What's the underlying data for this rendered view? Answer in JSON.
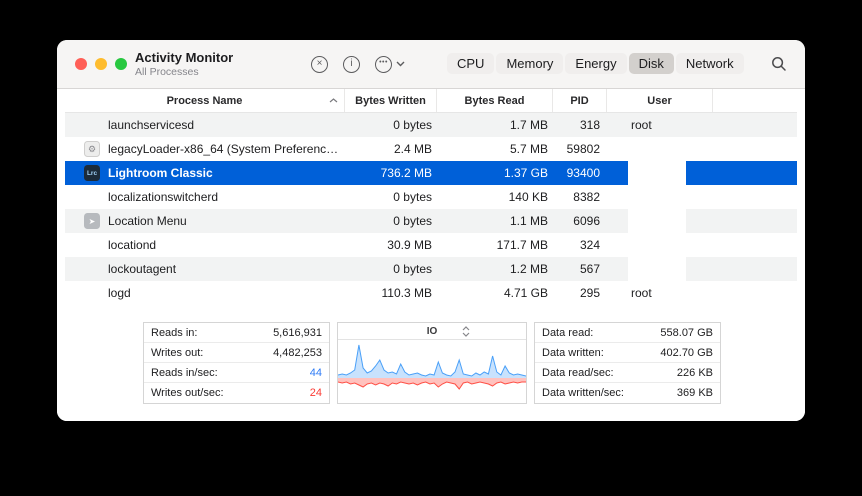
{
  "window": {
    "title": "Activity Monitor",
    "subtitle": "All Processes"
  },
  "colors": {
    "selection": "#0060d8",
    "chart_blue": "#4aa0f8",
    "chart_red": "#ff4f45",
    "chart_blue_fill": "rgba(74,160,248,0.30)",
    "chart_red_fill": "rgba(255,79,69,0.35)"
  },
  "toolbar": {
    "icons": {
      "quit": "×",
      "inspect": "i",
      "more": "•••"
    },
    "segments": [
      {
        "label": "CPU",
        "selected": false
      },
      {
        "label": "Memory",
        "selected": false
      },
      {
        "label": "Energy",
        "selected": false
      },
      {
        "label": "Disk",
        "selected": true
      },
      {
        "label": "Network",
        "selected": false
      }
    ]
  },
  "table": {
    "columns": [
      "Process Name",
      "Bytes Written",
      "Bytes Read",
      "PID",
      "User"
    ],
    "app_icon_glyphs": {
      "lrc": "Lrc",
      "legacy": "⚙",
      "location": "➤"
    },
    "rows": [
      {
        "name": "launchservicesd",
        "icon": "",
        "bytes_written": "0 bytes",
        "bytes_read": "1.7 MB",
        "pid": "318",
        "user": "root",
        "selected": false
      },
      {
        "name": "legacyLoader-x86_64 (System Preferenc…",
        "icon": "legacy",
        "bytes_written": "2.4 MB",
        "bytes_read": "5.7 MB",
        "pid": "59802",
        "user": "",
        "selected": false
      },
      {
        "name": "Lightroom Classic",
        "icon": "lrc",
        "bytes_written": "736.2 MB",
        "bytes_read": "1.37 GB",
        "pid": "93400",
        "user": "",
        "selected": true
      },
      {
        "name": "localizationswitcherd",
        "icon": "",
        "bytes_written": "0 bytes",
        "bytes_read": "140 KB",
        "pid": "8382",
        "user": "",
        "selected": false
      },
      {
        "name": "Location Menu",
        "icon": "location",
        "bytes_written": "0 bytes",
        "bytes_read": "1.1 MB",
        "pid": "6096",
        "user": "",
        "selected": false
      },
      {
        "name": "locationd",
        "icon": "",
        "bytes_written": "30.9 MB",
        "bytes_read": "171.7 MB",
        "pid": "324",
        "user": "",
        "selected": false
      },
      {
        "name": "lockoutagent",
        "icon": "",
        "bytes_written": "0 bytes",
        "bytes_read": "1.2 MB",
        "pid": "567",
        "user": "",
        "selected": false
      },
      {
        "name": "logd",
        "icon": "",
        "bytes_written": "110.3 MB",
        "bytes_read": "4.71 GB",
        "pid": "295",
        "user": "root",
        "selected": false
      }
    ]
  },
  "footer": {
    "left_stats": [
      {
        "label": "Reads in:",
        "value": "5,616,931"
      },
      {
        "label": "Writes out:",
        "value": "4,482,253"
      },
      {
        "label": "Reads in/sec:",
        "value": "44",
        "color": "#2e7bf6"
      },
      {
        "label": "Writes out/sec:",
        "value": "24",
        "color": "#fb3b34"
      }
    ],
    "chart": {
      "label": "IO",
      "blue": [
        3,
        4,
        3,
        5,
        8,
        33,
        10,
        5,
        7,
        12,
        18,
        8,
        5,
        6,
        4,
        14,
        6,
        3,
        4,
        5,
        3,
        2,
        4,
        3,
        16,
        5,
        3,
        2,
        6,
        18,
        4,
        3,
        2,
        5,
        3,
        6,
        4,
        22,
        6,
        3,
        12,
        5,
        3,
        4,
        3,
        2
      ],
      "red": [
        4,
        5,
        4,
        6,
        5,
        7,
        9,
        6,
        5,
        7,
        5,
        6,
        8,
        5,
        6,
        4,
        5,
        6,
        5,
        7,
        5,
        4,
        6,
        5,
        9,
        6,
        4,
        5,
        6,
        11,
        5,
        4,
        6,
        5,
        4,
        5,
        6,
        8,
        5,
        4,
        6,
        5,
        4,
        5,
        4,
        4
      ]
    },
    "right_stats": [
      {
        "label": "Data read:",
        "value": "558.07 GB"
      },
      {
        "label": "Data written:",
        "value": "402.70 GB"
      },
      {
        "label": "Data read/sec:",
        "value": "226 KB"
      },
      {
        "label": "Data written/sec:",
        "value": "369 KB"
      }
    ]
  }
}
